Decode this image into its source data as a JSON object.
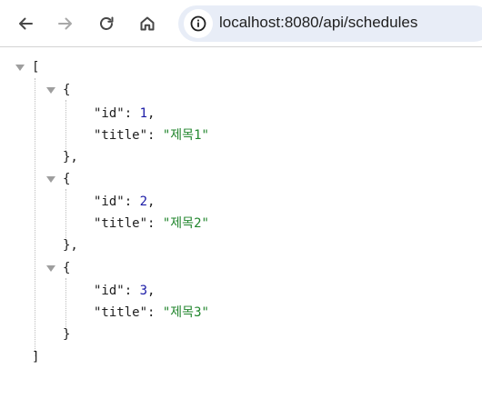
{
  "browser": {
    "url": "localhost:8080/api/schedules",
    "back_icon": "arrow-left-icon",
    "forward_icon": "arrow-right-icon",
    "reload_icon": "reload-icon",
    "home_icon": "home-icon",
    "site_info_icon": "info-circle-icon"
  },
  "json": {
    "open_array": "[",
    "close_array": "]",
    "items": [
      {
        "open": "{",
        "id_key": "\"id\"",
        "id_value": "1",
        "title_key": "\"title\"",
        "title_value": "\"제목1\"",
        "close": "},"
      },
      {
        "open": "{",
        "id_key": "\"id\"",
        "id_value": "2",
        "title_key": "\"title\"",
        "title_value": "\"제목2\"",
        "close": "},"
      },
      {
        "open": "{",
        "id_key": "\"id\"",
        "id_value": "3",
        "title_key": "\"title\"",
        "title_value": "\"제목3\"",
        "close": "}"
      }
    ],
    "colon": ": ",
    "comma": ","
  },
  "colors": {
    "number": "#1a1aa6",
    "string": "#22862e",
    "omnibox_bg": "#e8edf7"
  }
}
